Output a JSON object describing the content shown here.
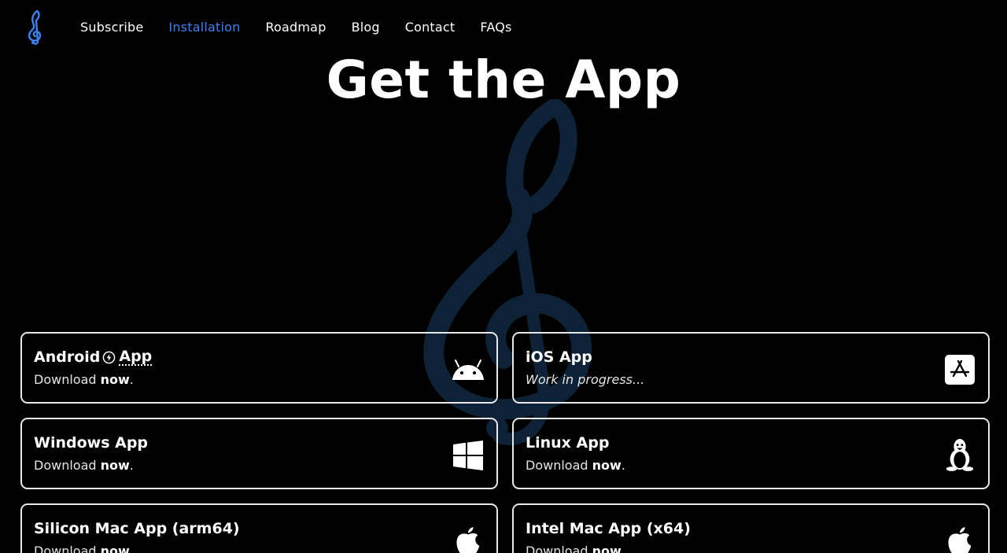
{
  "nav": {
    "logo_icon": "treble-clef-icon",
    "links": [
      {
        "label": "Subscribe",
        "active": false
      },
      {
        "label": "Installation",
        "active": true
      },
      {
        "label": "Roadmap",
        "active": false
      },
      {
        "label": "Blog",
        "active": false
      },
      {
        "label": "Contact",
        "active": false
      },
      {
        "label": "FAQs",
        "active": false
      }
    ]
  },
  "hero": {
    "title": "Get the App",
    "background_icon": "treble-clef-icon"
  },
  "cards": [
    {
      "title_prefix": "Android",
      "title_suffix": "App",
      "sub_pre": "Download",
      "sub_bold": "now",
      "sub_post": ".",
      "icon": "android-icon",
      "badge_icon": "lightning-icon"
    },
    {
      "title": "iOS App",
      "sub": "Work in progress...",
      "icon": "app-store-icon"
    },
    {
      "title": "Windows App",
      "sub_pre": "Download",
      "sub_bold": "now",
      "sub_post": ".",
      "icon": "windows-icon"
    },
    {
      "title": "Linux App",
      "sub_pre": "Download",
      "sub_bold": "now",
      "sub_post": ".",
      "icon": "linux-tux-icon"
    },
    {
      "title": "Silicon Mac App (arm64)",
      "sub_pre": "Download",
      "sub_bold": "now",
      "sub_post": ".",
      "icon": "apple-icon"
    },
    {
      "title": "Intel Mac App (x64)",
      "sub_pre": "Download",
      "sub_bold": "now",
      "sub_post": ".",
      "icon": "apple-icon"
    }
  ],
  "colors": {
    "background": "#000000",
    "accent": "#3b82f6",
    "clef_watermark": "#0d2236",
    "card_border": "#e8e8e8"
  }
}
